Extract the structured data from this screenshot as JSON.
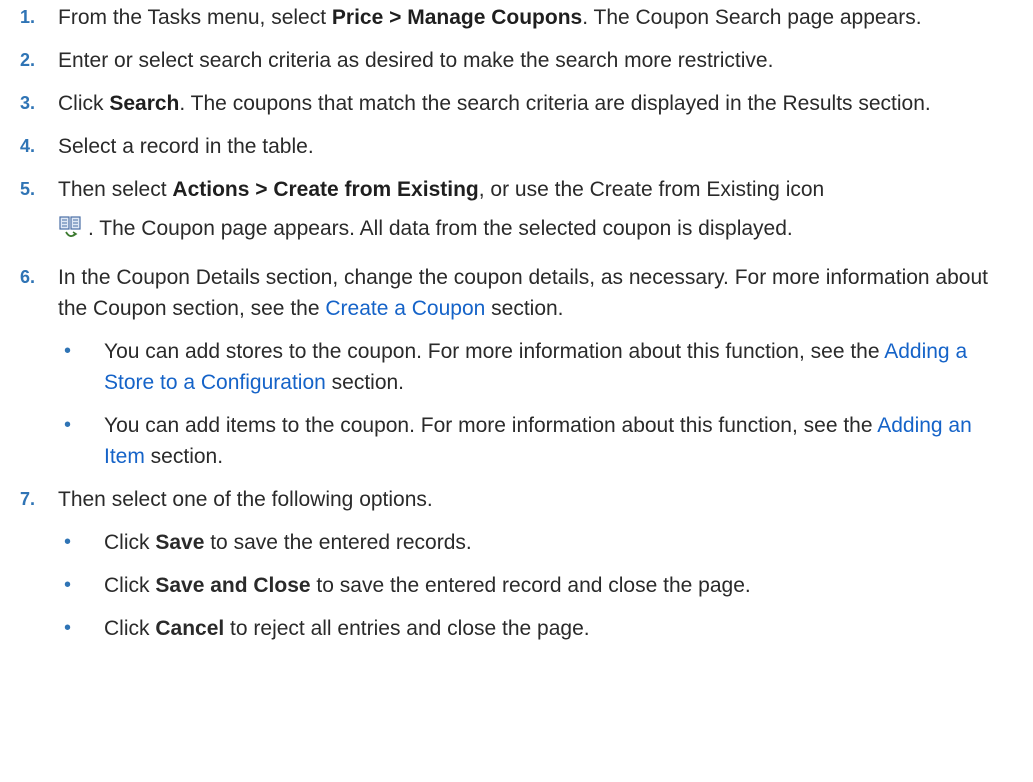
{
  "steps": [
    {
      "num": "1.",
      "parts": [
        {
          "t": "From the Tasks menu, select "
        },
        {
          "t": "Price > Manage Coupons",
          "b": true
        },
        {
          "t": ". The Coupon Search page appears."
        }
      ]
    },
    {
      "num": "2.",
      "parts": [
        {
          "t": "Enter or select search criteria as desired to make the search more restrictive."
        }
      ]
    },
    {
      "num": "3.",
      "parts": [
        {
          "t": "Click "
        },
        {
          "t": "Search",
          "b": true
        },
        {
          "t": ". The coupons that match the search criteria are displayed in the Results section."
        }
      ]
    },
    {
      "num": "4.",
      "parts": [
        {
          "t": "Select a record in the table."
        }
      ]
    },
    {
      "num": "5.",
      "parts": [
        {
          "t": "Then select "
        },
        {
          "t": "Actions > Create from Existing",
          "b": true
        },
        {
          "t": ", or use the Create from Existing icon"
        },
        {
          "icon": "create-from-existing-icon"
        },
        {
          "t": ". The Coupon page appears. All data from the selected coupon is displayed."
        }
      ]
    },
    {
      "num": "6.",
      "parts": [
        {
          "t": "In the Coupon Details section, change the coupon details, as necessary. For more information about the Coupon section, see the "
        },
        {
          "t": "Create a Coupon",
          "link": true
        },
        {
          "t": " section."
        }
      ],
      "bullets": [
        [
          {
            "t": "You can add stores to the coupon. For more information about this function, see the "
          },
          {
            "t": "Adding a Store to a Configuration",
            "link": true
          },
          {
            "t": " section."
          }
        ],
        [
          {
            "t": "You can add items to the coupon. For more information about this function, see the "
          },
          {
            "t": "Adding an Item",
            "link": true
          },
          {
            "t": " section."
          }
        ]
      ]
    },
    {
      "num": "7.",
      "parts": [
        {
          "t": "Then select one of the following options."
        }
      ],
      "bullets": [
        [
          {
            "t": "Click "
          },
          {
            "t": "Save",
            "b": true
          },
          {
            "t": " to save the entered records."
          }
        ],
        [
          {
            "t": "Click "
          },
          {
            "t": "Save and Close",
            "b": true
          },
          {
            "t": " to save the entered record and close the page."
          }
        ],
        [
          {
            "t": "Click "
          },
          {
            "t": "Cancel",
            "b": true
          },
          {
            "t": " to reject all entries and close the page."
          }
        ]
      ]
    }
  ],
  "bullet_glyph": "•",
  "colors": {
    "number": "#2f74b5",
    "link": "#1563c8",
    "text": "#2a2a2a"
  }
}
